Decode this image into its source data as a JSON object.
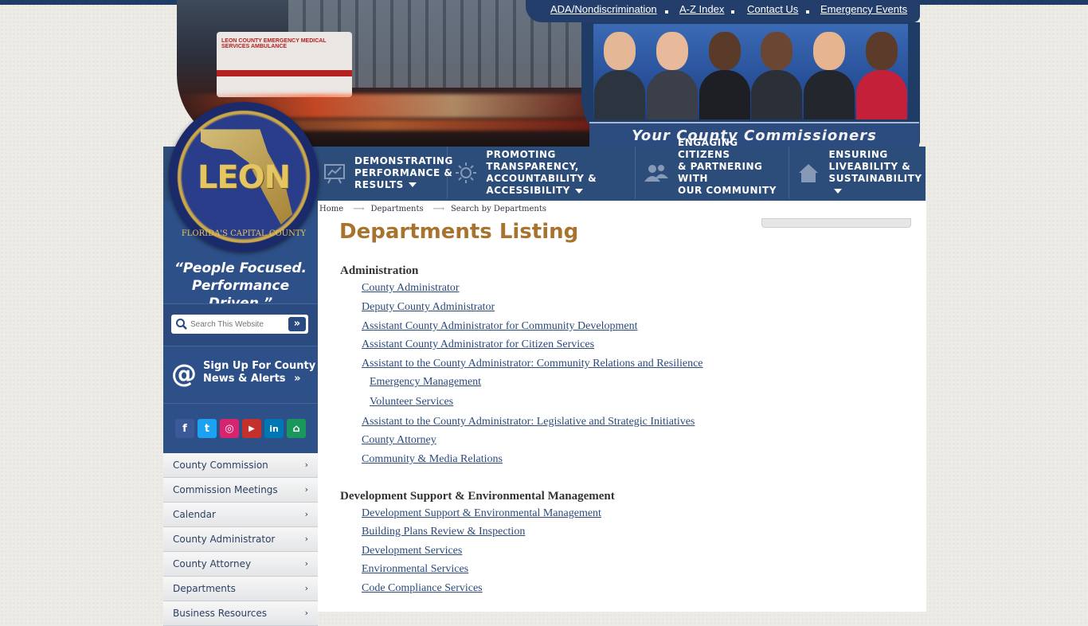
{
  "top_links": [
    "ADA/Nondiscrimination",
    "A-Z Index",
    "Contact Us",
    "Emergency Events"
  ],
  "hero": {
    "ambulance_text": "LEON COUNTY EMERGENCY MEDICAL SERVICES AMBULANCE"
  },
  "commissioners": {
    "caption": "Your County Commissioners"
  },
  "nav": [
    {
      "lines": [
        "DEMONSTRATING",
        "PERFORMANCE &",
        "RESULTS"
      ],
      "icon": "chart-icon"
    },
    {
      "lines": [
        "PROMOTING TRANSPARENCY,",
        "ACCOUNTABILITY &",
        "ACCESSIBILITY"
      ],
      "icon": "sun-icon"
    },
    {
      "lines": [
        "ENGAGING CITIZENS",
        "& PARTNERING WITH",
        "OUR COMMUNITY"
      ],
      "icon": "people-icon"
    },
    {
      "lines": [
        "ENSURING",
        "LIVEABILITY &",
        "SUSTAINABILITY"
      ],
      "icon": "house-icon"
    }
  ],
  "logo": {
    "name": "LEON",
    "ring_text": "FLORIDA'S CAPITAL COUNTY"
  },
  "tagline": [
    "“People Focused.",
    "Performance Driven.”"
  ],
  "search": {
    "placeholder": "Search This Website",
    "go": "»"
  },
  "signup": {
    "line1": "Sign Up For County",
    "line2": "News & Alerts",
    "arrow": "»"
  },
  "social": [
    {
      "name": "facebook-icon",
      "glyph": "f",
      "color": "#3b5998"
    },
    {
      "name": "twitter-icon",
      "glyph": "t",
      "color": "#1da1f2"
    },
    {
      "name": "instagram-icon",
      "glyph": "◎",
      "color": "#d6246e"
    },
    {
      "name": "youtube-icon",
      "glyph": "▶",
      "color": "#c4302b"
    },
    {
      "name": "linkedin-icon",
      "glyph": "in",
      "color": "#0077b5"
    },
    {
      "name": "nextdoor-icon",
      "glyph": "⌂",
      "color": "#19975d"
    }
  ],
  "sidebar_menu": [
    "County Commission",
    "Commission Meetings",
    "Calendar",
    "County Administrator",
    "County Attorney",
    "Departments",
    "Business Resources"
  ],
  "breadcrumb": [
    "Home",
    "Departments",
    "Search by Departments"
  ],
  "page_title": "Departments Listing",
  "sections": [
    {
      "heading": "Administration",
      "links": [
        {
          "text": "County Administrator",
          "indent": 1
        },
        {
          "text": "Deputy County Administrator",
          "indent": 1
        },
        {
          "text": "Assistant County Administrator for Community Development",
          "indent": 1
        },
        {
          "text": "Assistant County Administrator for Citizen Services",
          "indent": 1
        },
        {
          "text": "Assistant to the County Administrator: Community Relations and Resilience",
          "indent": 1
        },
        {
          "text": "Emergency Management",
          "indent": 2
        },
        {
          "text": "Volunteer Services",
          "indent": 2
        },
        {
          "text": "Assistant to the County Administrator: Legislative and Strategic Initiatives",
          "indent": 1
        },
        {
          "text": "County Attorney",
          "indent": 1
        },
        {
          "text": "Community & Media Relations",
          "indent": 1
        }
      ]
    },
    {
      "heading": "Development Support & Environmental Management",
      "links": [
        {
          "text": "Development Support & Environmental Management",
          "indent": 1
        },
        {
          "text": "Building Plans Review & Inspection",
          "indent": 1
        },
        {
          "text": "Development Services",
          "indent": 1
        },
        {
          "text": "Environmental Services",
          "indent": 1
        },
        {
          "text": "Code Compliance Services",
          "indent": 1
        }
      ]
    }
  ]
}
